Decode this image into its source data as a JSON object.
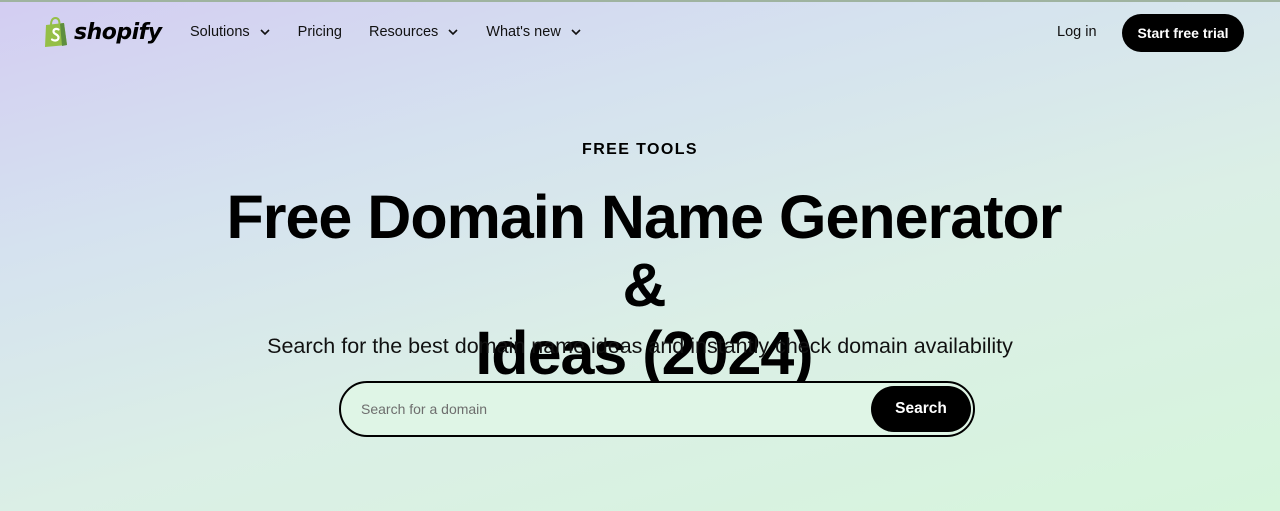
{
  "header": {
    "logo_text": "shopify",
    "nav": [
      {
        "label": "Solutions",
        "has_dropdown": true
      },
      {
        "label": "Pricing",
        "has_dropdown": false
      },
      {
        "label": "Resources",
        "has_dropdown": true
      },
      {
        "label": "What's new",
        "has_dropdown": true
      }
    ],
    "login_label": "Log in",
    "cta_label": "Start free trial"
  },
  "hero": {
    "eyebrow": "FREE TOOLS",
    "title_line1": "Free Domain Name Generator &",
    "title_line2": "Ideas (2024)",
    "subtitle": "Search for the best domain name ideas and instantly check domain availability",
    "search": {
      "placeholder": "Search for a domain",
      "value": "",
      "button_label": "Search"
    }
  },
  "colors": {
    "brand_green": "#95bf47",
    "brand_dark_green": "#5e8e3e",
    "button_bg": "#000000",
    "button_text": "#ffffff"
  },
  "icons": {
    "logo": "shopify-bag-icon",
    "dropdown": "chevron-down-icon"
  }
}
